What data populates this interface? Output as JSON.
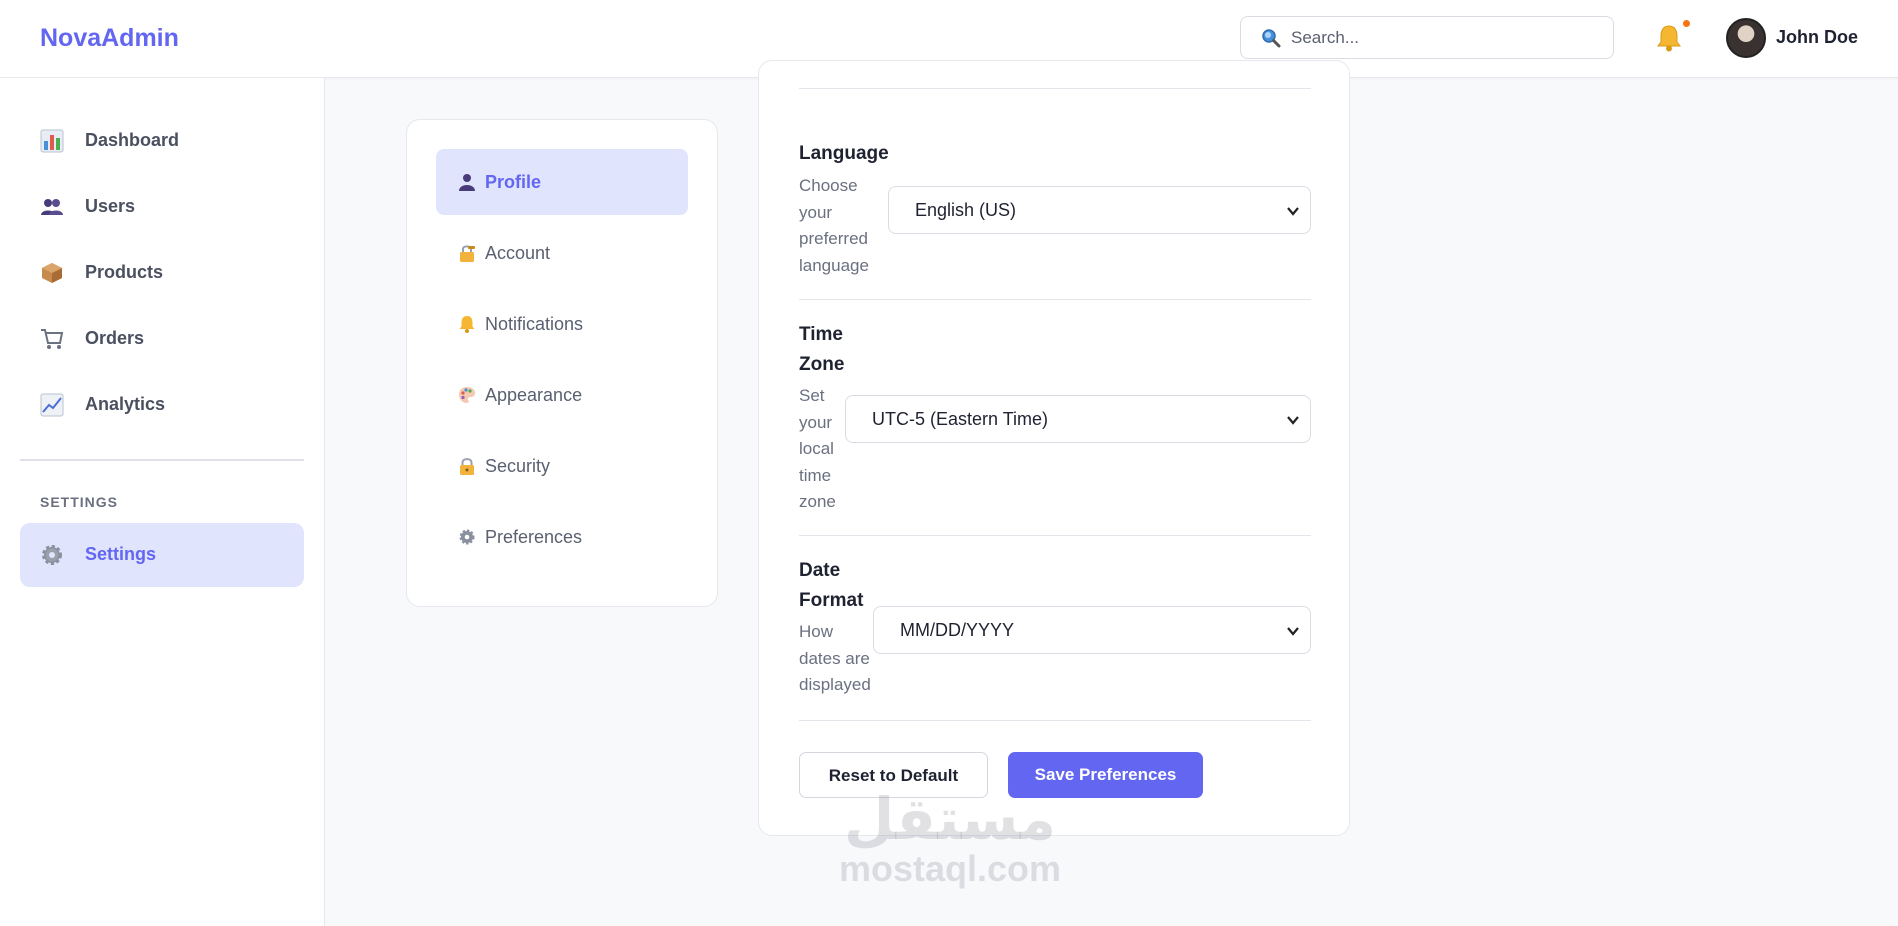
{
  "header": {
    "brand": "NovaAdmin",
    "search_placeholder": "Search...",
    "user_name": "John Doe",
    "notification_dot_color": "#f97316",
    "accent_color": "#6366f1"
  },
  "sidebar": {
    "items": [
      {
        "label": "Dashboard",
        "icon": "bar-chart-icon"
      },
      {
        "label": "Users",
        "icon": "users-icon"
      },
      {
        "label": "Products",
        "icon": "package-icon"
      },
      {
        "label": "Orders",
        "icon": "cart-icon"
      },
      {
        "label": "Analytics",
        "icon": "trend-chart-icon"
      }
    ],
    "section_title": "SETTINGS",
    "settings_item": {
      "label": "Settings",
      "icon": "gear-icon",
      "active": true
    }
  },
  "settings_nav": {
    "items": [
      {
        "label": "Profile",
        "icon": "person-icon",
        "active": true
      },
      {
        "label": "Account",
        "icon": "lock-key-icon"
      },
      {
        "label": "Notifications",
        "icon": "bell-icon"
      },
      {
        "label": "Appearance",
        "icon": "palette-icon"
      },
      {
        "label": "Security",
        "icon": "lock-icon"
      },
      {
        "label": "Preferences",
        "icon": "gear-icon"
      }
    ]
  },
  "preferences": {
    "language": {
      "title": "Language",
      "description": "Choose your preferred language",
      "value": "English (US)"
    },
    "timezone": {
      "title": "Time Zone",
      "description": "Set your local time zone",
      "value": "UTC-5 (Eastern Time)"
    },
    "date_format": {
      "title": "Date Format",
      "description": "How dates are displayed",
      "value": "MM/DD/YYYY"
    },
    "reset_label": "Reset to Default",
    "save_label": "Save Preferences"
  },
  "watermark": {
    "arabic": "مستقل",
    "latin": "mostaql.com"
  }
}
